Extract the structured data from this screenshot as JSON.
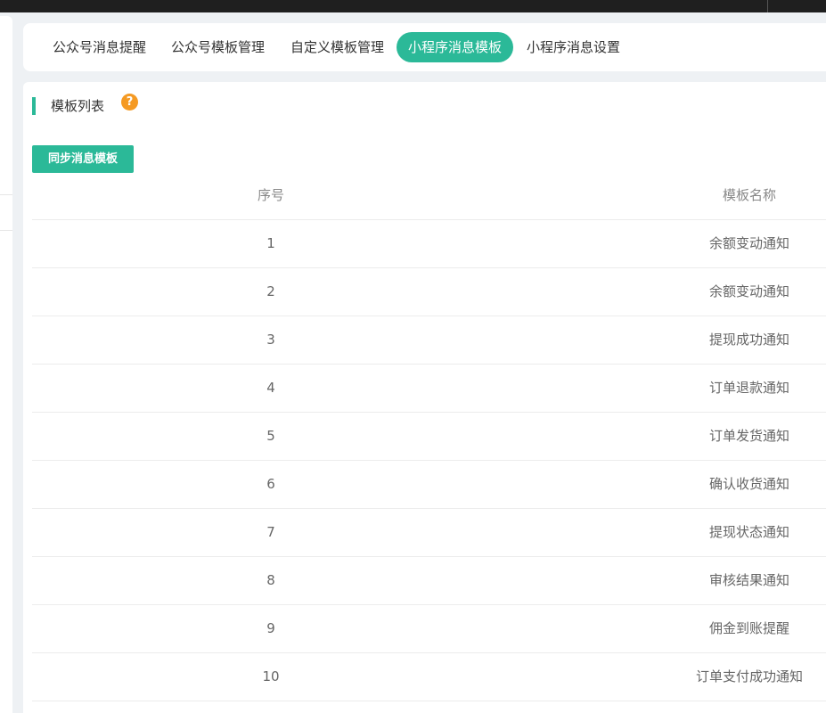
{
  "tabs": [
    {
      "label": "公众号消息提醒",
      "active": false
    },
    {
      "label": "公众号模板管理",
      "active": false
    },
    {
      "label": "自定义模板管理",
      "active": false
    },
    {
      "label": "小程序消息模板",
      "active": true
    },
    {
      "label": "小程序消息设置",
      "active": false
    }
  ],
  "section": {
    "title": "模板列表",
    "help_icon": "?"
  },
  "toolbar": {
    "sync_label": "同步消息模板"
  },
  "table": {
    "columns": [
      "序号",
      "模板名称"
    ],
    "rows": [
      {
        "index": "1",
        "name": "余额变动通知"
      },
      {
        "index": "2",
        "name": "余额变动通知"
      },
      {
        "index": "3",
        "name": "提现成功通知"
      },
      {
        "index": "4",
        "name": "订单退款通知"
      },
      {
        "index": "5",
        "name": "订单发货通知"
      },
      {
        "index": "6",
        "name": "确认收货通知"
      },
      {
        "index": "7",
        "name": "提现状态通知"
      },
      {
        "index": "8",
        "name": "审核结果通知"
      },
      {
        "index": "9",
        "name": "佣金到账提醒"
      },
      {
        "index": "10",
        "name": "订单支付成功通知"
      }
    ]
  },
  "colors": {
    "accent": "#2bb998",
    "help": "#f59a23"
  }
}
